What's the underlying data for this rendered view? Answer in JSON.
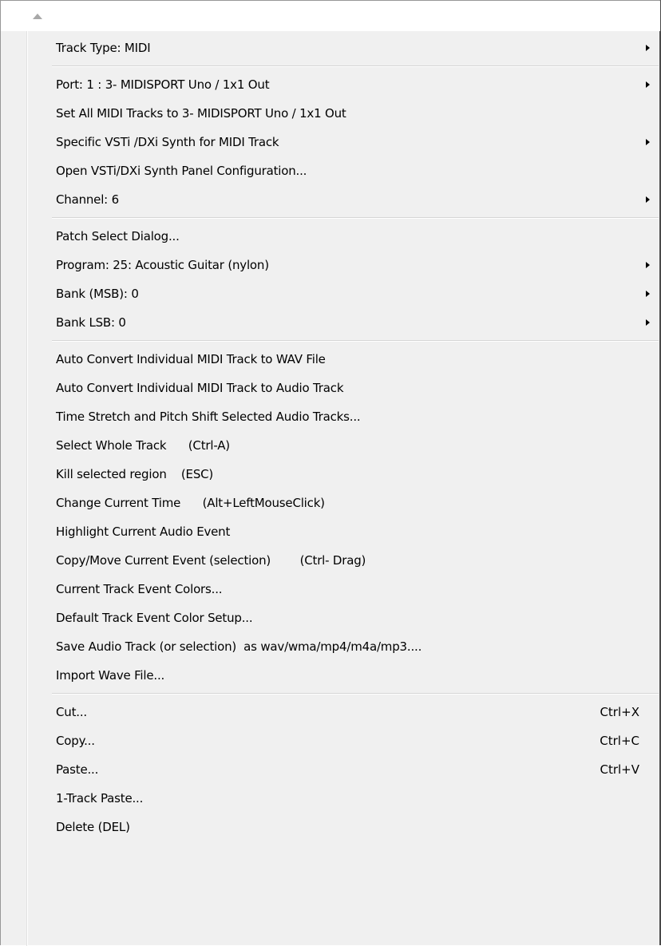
{
  "menu": {
    "scroll_up_icon": "triangle-up-icon",
    "submenu_icon": "triangle-right-icon",
    "groups": [
      {
        "items": [
          {
            "label": "Track Type: MIDI",
            "submenu": true
          }
        ]
      },
      {
        "items": [
          {
            "label": "Port: 1 : 3- MIDISPORT Uno / 1x1 Out",
            "submenu": true
          },
          {
            "label": "Set All MIDI Tracks to 3- MIDISPORT Uno / 1x1 Out"
          },
          {
            "label": "Specific VSTi /DXi Synth for MIDI Track",
            "submenu": true
          },
          {
            "label": "Open VSTi/DXi Synth Panel Configuration..."
          },
          {
            "label": "Channel: 6",
            "submenu": true
          }
        ]
      },
      {
        "items": [
          {
            "label": "Patch Select Dialog..."
          },
          {
            "label": "Program: 25: Acoustic Guitar (nylon)",
            "submenu": true
          },
          {
            "label": "Bank (MSB): 0",
            "submenu": true
          },
          {
            "label": "Bank LSB: 0",
            "submenu": true
          }
        ]
      },
      {
        "items": [
          {
            "label": "Auto Convert Individual MIDI Track to WAV File"
          },
          {
            "label": "Auto Convert Individual MIDI Track to Audio Track"
          },
          {
            "label": "Time Stretch and Pitch Shift Selected Audio Tracks..."
          },
          {
            "label": "Select Whole Track      (Ctrl-A)"
          },
          {
            "label": "Kill selected region    (ESC)"
          },
          {
            "label": "Change Current Time      (Alt+LeftMouseClick)"
          },
          {
            "label": "Highlight Current Audio Event"
          },
          {
            "label": "Copy/Move Current Event (selection)        (Ctrl- Drag)"
          },
          {
            "label": "Current Track Event Colors..."
          },
          {
            "label": "Default Track Event Color Setup..."
          },
          {
            "label": "Save Audio Track (or selection)  as wav/wma/mp4/m4a/mp3...."
          },
          {
            "label": "Import Wave File..."
          }
        ]
      },
      {
        "items": [
          {
            "label": "Cut...",
            "shortcut": "Ctrl+X"
          },
          {
            "label": "Copy...",
            "shortcut": "Ctrl+C"
          },
          {
            "label": "Paste...",
            "shortcut": "Ctrl+V"
          },
          {
            "label": "1-Track Paste..."
          },
          {
            "label": "Delete (DEL)"
          }
        ]
      }
    ]
  }
}
